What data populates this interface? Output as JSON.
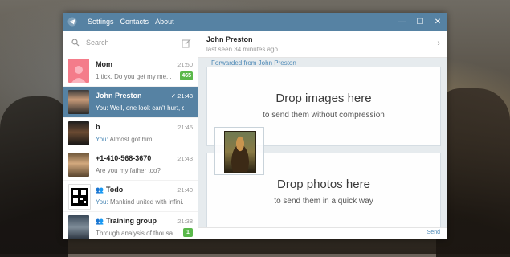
{
  "window": {
    "menu": [
      "Settings",
      "Contacts",
      "About"
    ]
  },
  "search": {
    "placeholder": "Search"
  },
  "chats": [
    {
      "name": "Mom",
      "time": "21:50",
      "preview": "1 tick. Do you get my me...",
      "you": "",
      "badge": "465"
    },
    {
      "name": "John Preston",
      "time": "21:48",
      "you": "You:",
      "preview": " Well, one look can't hurt, c",
      "badge": ""
    },
    {
      "name": "b",
      "time": "21:45",
      "you": "You:",
      "preview": " Almost got him.",
      "badge": ""
    },
    {
      "name": "+1-410-568-3670",
      "time": "21:43",
      "you": "",
      "preview": "Are you my father too?",
      "badge": ""
    },
    {
      "name": "Todo",
      "time": "21:40",
      "you": "You:",
      "preview": " Mankind united with infini...",
      "badge": ""
    },
    {
      "name": "Training group",
      "time": "21:38",
      "you": "",
      "preview": "Through analysis of thousa...",
      "badge": "1"
    }
  ],
  "conversation": {
    "peer_name": "John Preston",
    "status": "last seen 34 minutes ago",
    "forwarded": "Forwarded from John Preston",
    "composer_send": "Send"
  },
  "drop_zones": [
    {
      "title": "Drop images here",
      "subtitle": "to send them without compression"
    },
    {
      "title": "Drop photos here",
      "subtitle": "to send them in a quick way"
    }
  ],
  "colors": {
    "accent": "#5682a3",
    "badge": "#5ab84a",
    "link": "#4d89b6"
  }
}
